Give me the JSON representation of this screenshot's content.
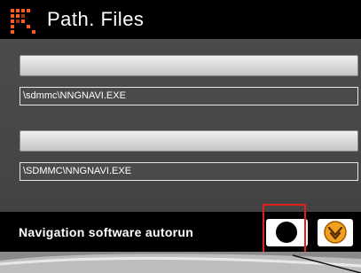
{
  "header": {
    "title": "Path. Files"
  },
  "paths": {
    "first": "\\sdmmc\\NNGNAVI.EXE",
    "second": "\\SDMMC\\NNGNAVI.EXE"
  },
  "autorun": {
    "label": "Navigation software autorun"
  },
  "colors": {
    "accent": "#ff5a1f",
    "highlight": "#e0201a"
  }
}
